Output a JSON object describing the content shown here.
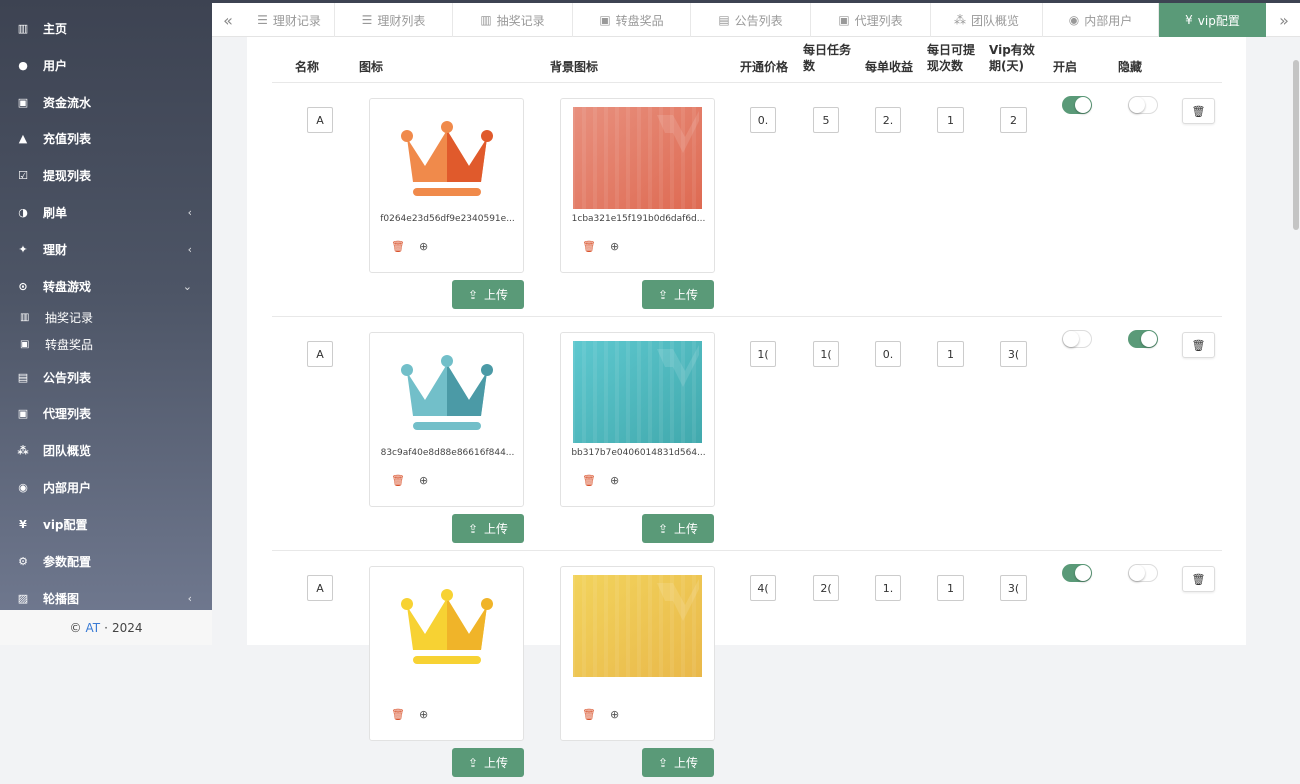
{
  "sidebar": {
    "items": [
      {
        "icon": "bar-chart-icon",
        "glyph": "▥",
        "label": "主页",
        "arrow": ""
      },
      {
        "icon": "user-icon",
        "glyph": "●",
        "label": "用户",
        "arrow": ""
      },
      {
        "icon": "money-icon",
        "glyph": "▣",
        "label": "资金流水",
        "arrow": ""
      },
      {
        "icon": "recharge-icon",
        "glyph": "▲",
        "label": "充值列表",
        "arrow": ""
      },
      {
        "icon": "check-square-icon",
        "glyph": "☑",
        "label": "提现列表",
        "arrow": ""
      },
      {
        "icon": "half-circle-icon",
        "glyph": "◑",
        "label": "刷单",
        "arrow": "‹"
      },
      {
        "icon": "finance-icon",
        "glyph": "✦",
        "label": "理财",
        "arrow": "‹"
      },
      {
        "icon": "gamepad-icon",
        "glyph": "⊙",
        "label": "转盘游戏",
        "arrow": "⌄"
      },
      {
        "icon": "file-icon",
        "glyph": "▤",
        "label": "公告列表",
        "arrow": ""
      },
      {
        "icon": "agent-icon",
        "glyph": "▣",
        "label": "代理列表",
        "arrow": ""
      },
      {
        "icon": "team-icon",
        "glyph": "⁂",
        "label": "团队概览",
        "arrow": ""
      },
      {
        "icon": "user-circle-icon",
        "glyph": "◉",
        "label": "内部用户",
        "arrow": ""
      },
      {
        "icon": "vip-icon",
        "glyph": "¥",
        "label": "vip配置",
        "arrow": ""
      },
      {
        "icon": "cogs-icon",
        "glyph": "⚙",
        "label": "参数配置",
        "arrow": ""
      },
      {
        "icon": "image-icon",
        "glyph": "▨",
        "label": "轮播图",
        "arrow": "‹"
      }
    ],
    "subitems": [
      {
        "icon": "bars-icon",
        "glyph": "▥",
        "label": "抽奖记录"
      },
      {
        "icon": "prize-icon",
        "glyph": "▣",
        "label": "转盘奖品"
      }
    ],
    "footer": {
      "copy": "©",
      "brand": "AT",
      "dot": "·",
      "year": "2024"
    }
  },
  "tabs": [
    {
      "icon": "list-icon",
      "glyph": "☰",
      "label": "理财记录"
    },
    {
      "icon": "list-icon",
      "glyph": "☰",
      "label": "理财列表"
    },
    {
      "icon": "bars-icon",
      "glyph": "▥",
      "label": "抽奖记录"
    },
    {
      "icon": "prize-icon",
      "glyph": "▣",
      "label": "转盘奖品"
    },
    {
      "icon": "file-icon",
      "glyph": "▤",
      "label": "公告列表"
    },
    {
      "icon": "agent-icon",
      "glyph": "▣",
      "label": "代理列表"
    },
    {
      "icon": "team-icon",
      "glyph": "⁂",
      "label": "团队概览"
    },
    {
      "icon": "user-circle-icon",
      "glyph": "◉",
      "label": "内部用户"
    },
    {
      "icon": "vip-icon",
      "glyph": "¥",
      "label": "vip配置"
    }
  ],
  "nav": {
    "prev": "«",
    "next": "»"
  },
  "table": {
    "headers": {
      "name": "名称",
      "icon": "图标",
      "bg_icon": "背景图标",
      "price": "开通价格",
      "tasks_a": "每日任务",
      "tasks_b": "数",
      "income": "每单收益",
      "withdraw_a": "每日可提",
      "withdraw_b": "现次数",
      "valid_a": "Vip有效",
      "valid_b": "期(天)",
      "enabled": "开启",
      "hidden": "隐藏"
    },
    "upload_label": "上传",
    "rows": [
      {
        "name": "A",
        "icon_file": "f0264e23d56df9e2340591e...",
        "bg_file": "1cba321e15f191b0d6daf6d...",
        "price": "0.",
        "tasks": "5",
        "income": "2.",
        "withdraw": "1",
        "valid": "2",
        "enabled": true,
        "hidden": false,
        "colors": {
          "crown_light": "#f08a4b",
          "crown_dark": "#e05a2c",
          "bg_start": "#e8907e",
          "bg_end": "#de6a52"
        }
      },
      {
        "name": "A",
        "icon_file": "83c9af40e8d88e86616f844...",
        "bg_file": "bb317b7e0406014831d564...",
        "price": "1(",
        "tasks": "1(",
        "income": "0.",
        "withdraw": "1",
        "valid": "3(",
        "enabled": false,
        "hidden": true,
        "colors": {
          "crown_light": "#72bfc9",
          "crown_dark": "#4b9aa6",
          "bg_start": "#5ec8cf",
          "bg_end": "#41a9ad"
        }
      },
      {
        "name": "A",
        "icon_file": "",
        "bg_file": "",
        "price": "4(",
        "tasks": "2(",
        "income": "1.",
        "withdraw": "1",
        "valid": "3(",
        "enabled": true,
        "hidden": false,
        "colors": {
          "crown_light": "#f7d233",
          "crown_dark": "#f0b429",
          "bg_start": "#f2d35c",
          "bg_end": "#e9b84a"
        }
      }
    ]
  }
}
